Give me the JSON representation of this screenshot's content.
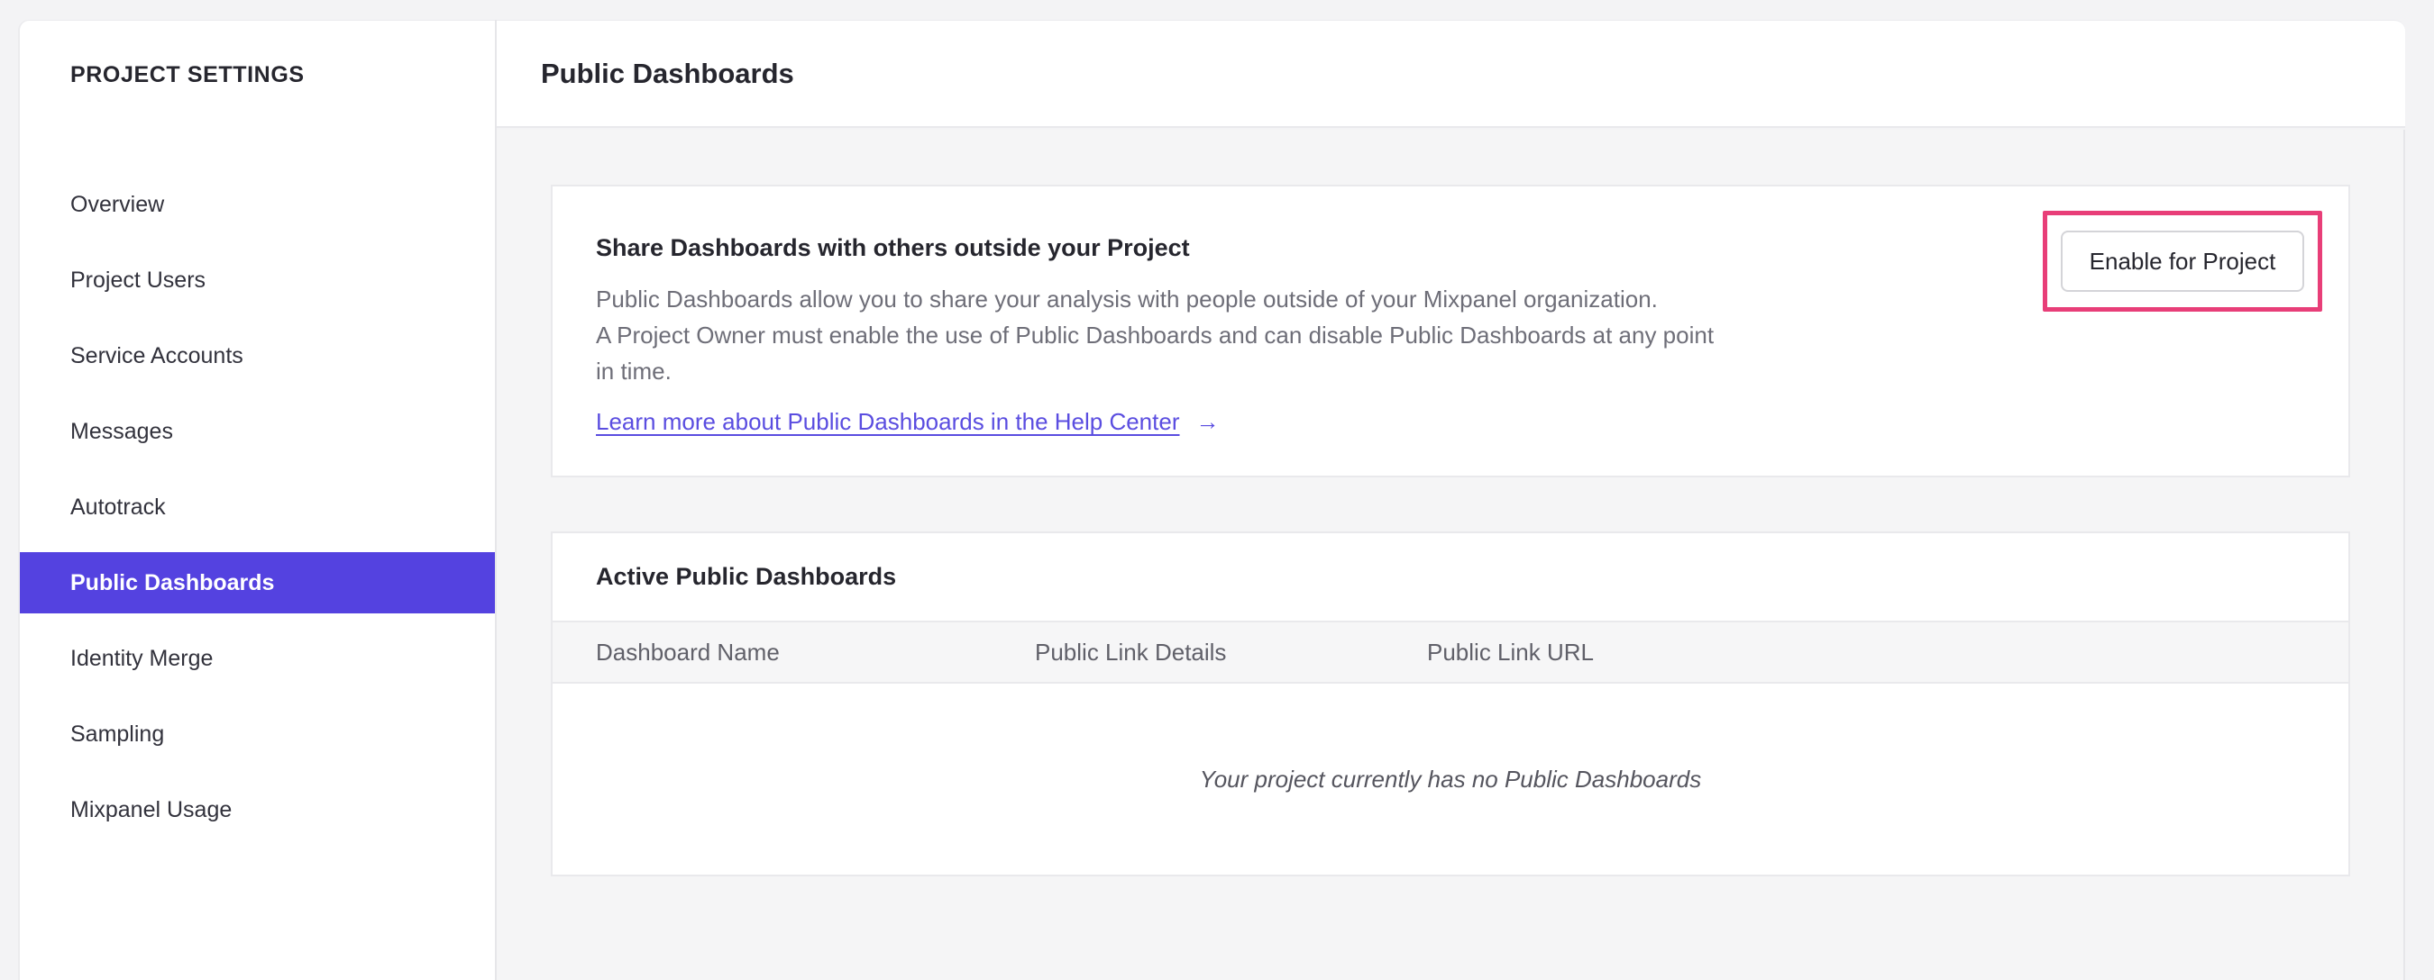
{
  "sidebar": {
    "title": "PROJECT SETTINGS",
    "items": [
      {
        "label": "Overview",
        "active": false
      },
      {
        "label": "Project Users",
        "active": false
      },
      {
        "label": "Service Accounts",
        "active": false
      },
      {
        "label": "Messages",
        "active": false
      },
      {
        "label": "Autotrack",
        "active": false
      },
      {
        "label": "Public Dashboards",
        "active": true
      },
      {
        "label": "Identity Merge",
        "active": false
      },
      {
        "label": "Sampling",
        "active": false
      },
      {
        "label": "Mixpanel Usage",
        "active": false
      }
    ]
  },
  "header": {
    "title": "Public Dashboards"
  },
  "share_card": {
    "heading": "Share Dashboards with others outside your Project",
    "body_lines": [
      "Public Dashboards allow you to share your analysis with people outside of your Mixpanel organization.",
      "A Project Owner must enable the use of Public Dashboards and can disable Public Dashboards at any point",
      "in time."
    ],
    "link_label": "Learn more about Public Dashboards in the Help Center",
    "link_arrow": "→",
    "enable_button_label": "Enable for Project"
  },
  "active_card": {
    "title": "Active Public Dashboards",
    "columns": [
      "Dashboard Name",
      "Public Link Details",
      "Public Link URL"
    ],
    "empty_message": "Your project currently has no Public Dashboards"
  },
  "colors": {
    "accent_purple": "#5442e0",
    "link_purple": "#5a4de0",
    "annotation_pink": "#e83e78",
    "text_dark": "#26262e",
    "text_gray": "#6e6e78"
  }
}
